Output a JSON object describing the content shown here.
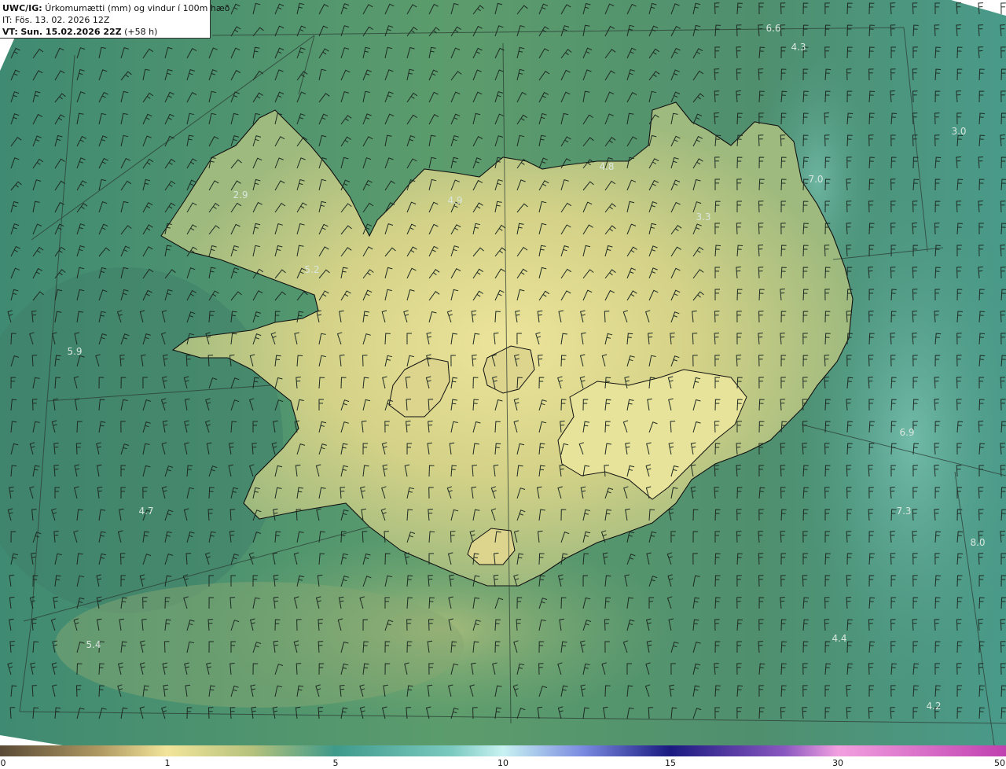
{
  "header": {
    "product": "UWC/IG:",
    "title": "Úrkomumætti (mm) og vindur í 100m hæð",
    "issue_time": "IT: Fös. 13. 02. 2026 12Z",
    "valid_prefix": "VT:",
    "valid_time": "Sun. 15.02.2026 22Z",
    "lead": "(+58 h)"
  },
  "map": {
    "region": "Iceland",
    "field_values": [
      {
        "id": "lbl-1",
        "text": "6.6"
      },
      {
        "id": "lbl-2",
        "text": "4.3"
      },
      {
        "id": "lbl-3",
        "text": "3.0"
      },
      {
        "id": "lbl-4",
        "text": "4.8"
      },
      {
        "id": "lbl-5",
        "text": "7.0"
      },
      {
        "id": "lbl-6",
        "text": "4.9"
      },
      {
        "id": "lbl-7",
        "text": "2.9"
      },
      {
        "id": "lbl-8",
        "text": "3.3"
      },
      {
        "id": "lbl-9",
        "text": "5.2"
      },
      {
        "id": "lbl-10",
        "text": "5.9"
      },
      {
        "id": "lbl-11",
        "text": "6.9"
      },
      {
        "id": "lbl-12",
        "text": "4.7"
      },
      {
        "id": "lbl-13",
        "text": "7.3"
      },
      {
        "id": "lbl-14",
        "text": "8.0"
      },
      {
        "id": "lbl-15",
        "text": "5.4"
      },
      {
        "id": "lbl-16",
        "text": "4.4"
      },
      {
        "id": "lbl-17",
        "text": "4.2"
      }
    ]
  },
  "colorbar": {
    "ticks": [
      "0",
      "1",
      "5",
      "10",
      "15",
      "30",
      "50"
    ],
    "colors": [
      "#5a4a36",
      "#c8b070",
      "#f2e59a",
      "#3f9a8a",
      "#c8f2f2",
      "#4a5ad0",
      "#1a1a80",
      "#b060c0",
      "#f2a0e0",
      "#c040b0"
    ]
  }
}
